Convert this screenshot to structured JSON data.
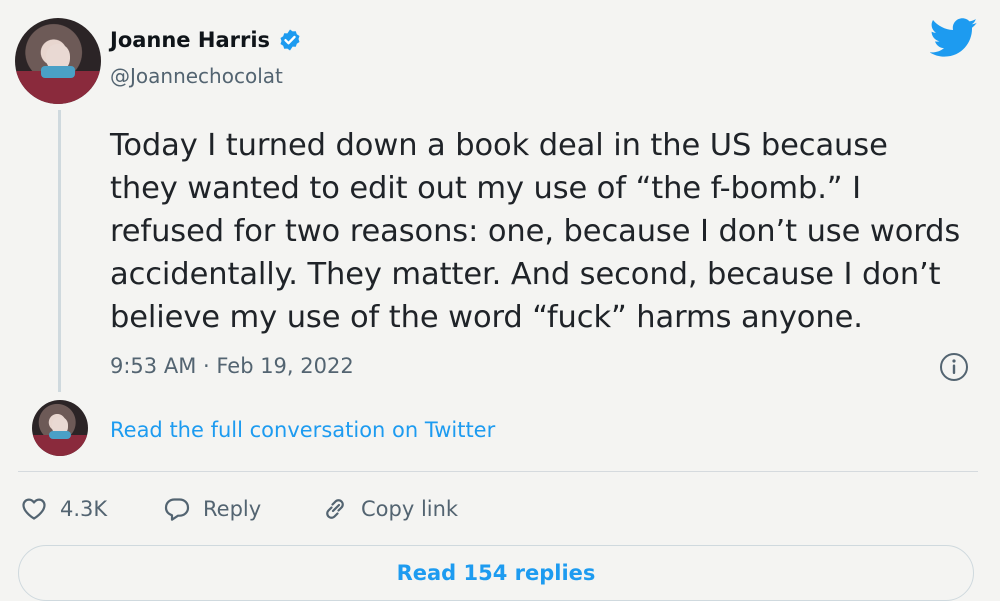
{
  "author": {
    "name": "Joanne Harris",
    "handle": "@Joannechocolat",
    "verified_icon": "verified-badge-icon",
    "avatar": "avatar"
  },
  "brand": {
    "logo": "twitter-bird-icon",
    "color": "#1d9bf0"
  },
  "tweet": {
    "lines": [
      "Today I turned down a book deal in the US because",
      "they wanted to edit out my use of “the f-bomb.” I",
      "refused for two reasons: one, because I don’t use words",
      "accidentally. They matter. And second, because I don’t",
      "believe my use of the word “fuck” harms anyone."
    ],
    "timestamp": "9:53 AM · Feb 19, 2022",
    "info_icon": "info-icon"
  },
  "conversation": {
    "link_text": "Read the full conversation on Twitter"
  },
  "actions": {
    "like_count": "4.3K",
    "reply_label": "Reply",
    "copy_link_label": "Copy link"
  },
  "replies_button": {
    "label": "Read 154 replies"
  }
}
